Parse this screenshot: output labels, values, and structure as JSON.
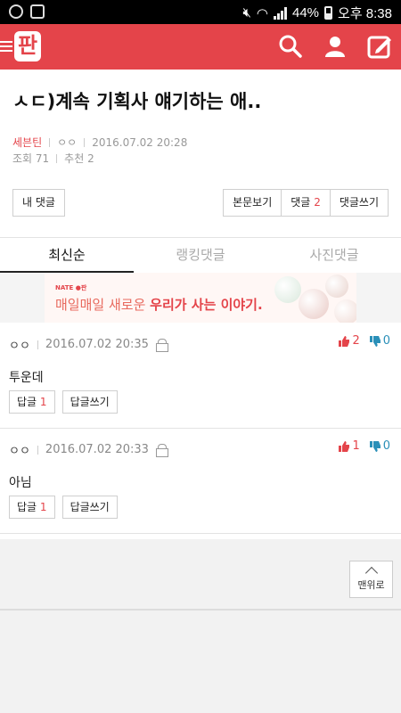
{
  "status_bar": {
    "battery": "44%",
    "time": "오후 8:38"
  },
  "header": {
    "logo_text": "판",
    "icons": [
      "search-icon",
      "user-icon",
      "write-icon"
    ]
  },
  "post": {
    "title": "ㅅㄷ)계속 기획사 얘기하는 애..",
    "author": "세븐틴",
    "nickname": "ㅇㅇ",
    "date": "2016.07.02 20:28",
    "views_label": "조회 71",
    "recommend_label": "추천 2"
  },
  "actions": {
    "my_comments": "내 댓글",
    "view_post": "본문보기",
    "comments_label": "댓글",
    "comments_count": "2",
    "write_comment": "댓글쓰기"
  },
  "tabs": [
    {
      "label": "최신순",
      "active": true
    },
    {
      "label": "랭킹댓글",
      "active": false
    },
    {
      "label": "사진댓글",
      "active": false
    }
  ],
  "banner": {
    "brand": "NATE ●판",
    "text_plain": "매일매일 새로운 ",
    "text_bold": "우리가 사는 이야기."
  },
  "comments": [
    {
      "author": "ㅇㅇ",
      "date": "2016.07.02 20:35",
      "upvotes": "2",
      "downvotes": "0",
      "body": "투운데",
      "reply_label": "답글",
      "reply_count": "1",
      "write_reply_label": "답글쓰기"
    },
    {
      "author": "ㅇㅇ",
      "date": "2016.07.02 20:33",
      "upvotes": "1",
      "downvotes": "0",
      "body": "아님",
      "reply_label": "답글",
      "reply_count": "1",
      "write_reply_label": "답글쓰기"
    }
  ],
  "scroll_top_label": "맨위로",
  "colors": {
    "brand": "#e4444a",
    "downvote": "#2a8fb8"
  }
}
